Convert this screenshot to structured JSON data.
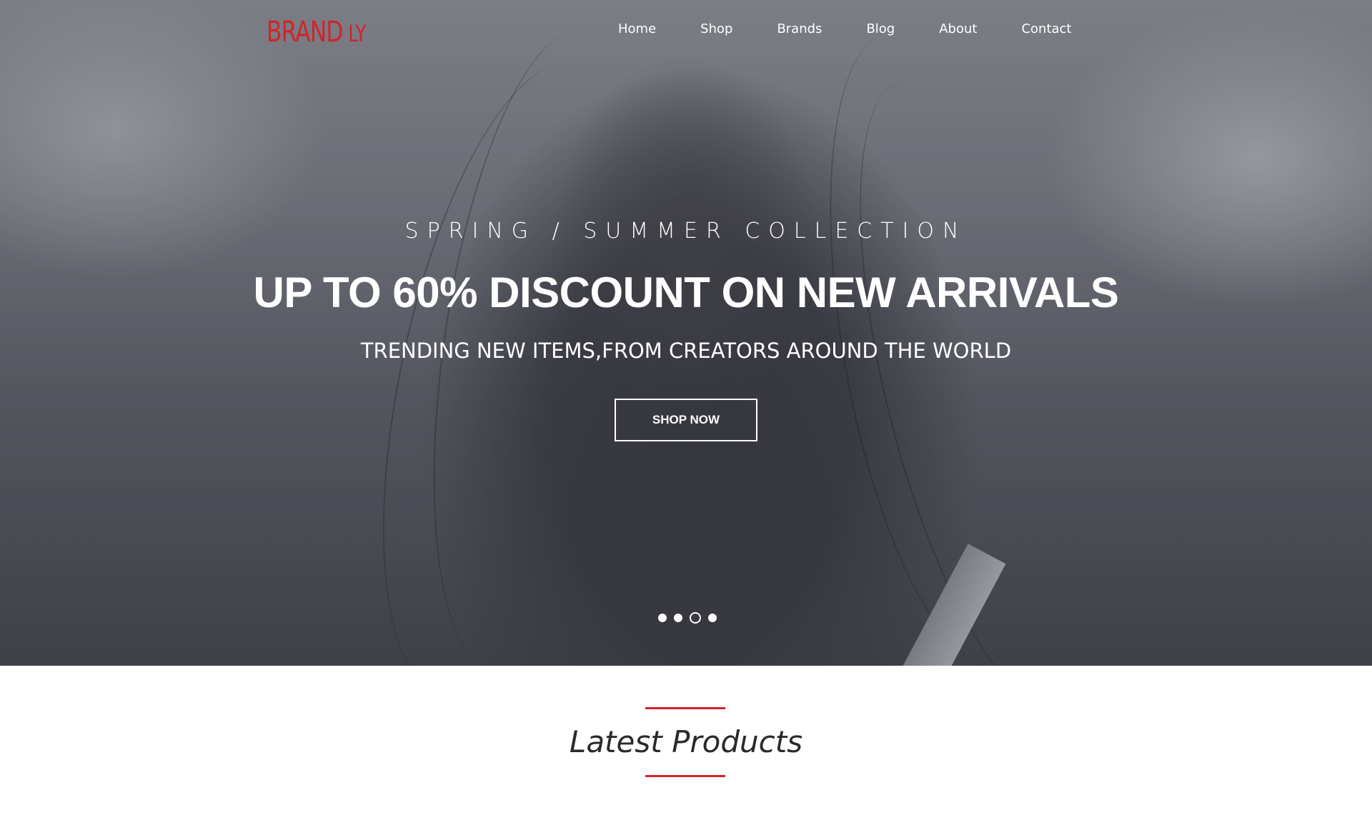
{
  "brand": {
    "main": "BRAND",
    "suffix": "LY"
  },
  "nav": {
    "items": [
      "Home",
      "Shop",
      "Brands",
      "Blog",
      "About",
      "Contact"
    ]
  },
  "hero": {
    "kicker": "SPRING / SUMMER COLLECTION",
    "headline": "UP TO 60% DISCOUNT ON NEW ARRIVALS",
    "subhead": "TRENDING NEW ITEMS,FROM CREATORS AROUND THE WORLD",
    "cta_label": "SHOP NOW",
    "slides_total": 4,
    "active_slide": 3
  },
  "latest": {
    "title": "Latest Products"
  },
  "colors": {
    "accent": "#d2232a",
    "hero_text": "#ffffff",
    "title_text": "#2a2a2a"
  }
}
